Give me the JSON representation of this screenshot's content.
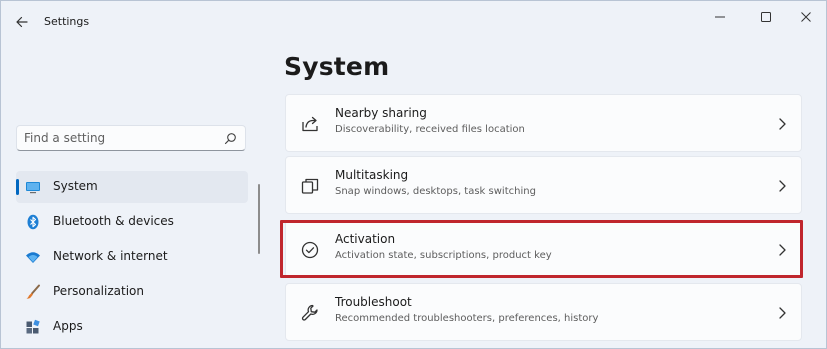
{
  "titlebar": {
    "title": "Settings",
    "back_icon": "arrow-left-icon",
    "controls": [
      "minimize-icon",
      "maximize-icon",
      "close-icon"
    ]
  },
  "sidebar": {
    "search": {
      "placeholder": "Find a setting",
      "icon": "search-icon"
    },
    "items": [
      {
        "label": "System",
        "icon": "monitor-icon",
        "selected": true
      },
      {
        "label": "Bluetooth & devices",
        "icon": "bluetooth-icon",
        "selected": false
      },
      {
        "label": "Network & internet",
        "icon": "wifi-icon",
        "selected": false
      },
      {
        "label": "Personalization",
        "icon": "paintbrush-icon",
        "selected": false
      },
      {
        "label": "Apps",
        "icon": "apps-icon",
        "selected": false
      }
    ]
  },
  "main": {
    "title": "System",
    "cards": [
      {
        "title": "Nearby sharing",
        "subtitle": "Discoverability, received files location",
        "icon": "share-icon"
      },
      {
        "title": "Multitasking",
        "subtitle": "Snap windows, desktops, task switching",
        "icon": "multitasking-icon"
      },
      {
        "title": "Activation",
        "subtitle": "Activation state, subscriptions, product key",
        "icon": "check-circle-icon",
        "highlighted": true
      },
      {
        "title": "Troubleshoot",
        "subtitle": "Recommended troubleshooters, preferences, history",
        "icon": "wrench-icon"
      }
    ]
  },
  "colors": {
    "accent": "#0067c0",
    "highlight": "#c0262d",
    "background": "#eef2f8",
    "card": "#fbfcfd"
  }
}
